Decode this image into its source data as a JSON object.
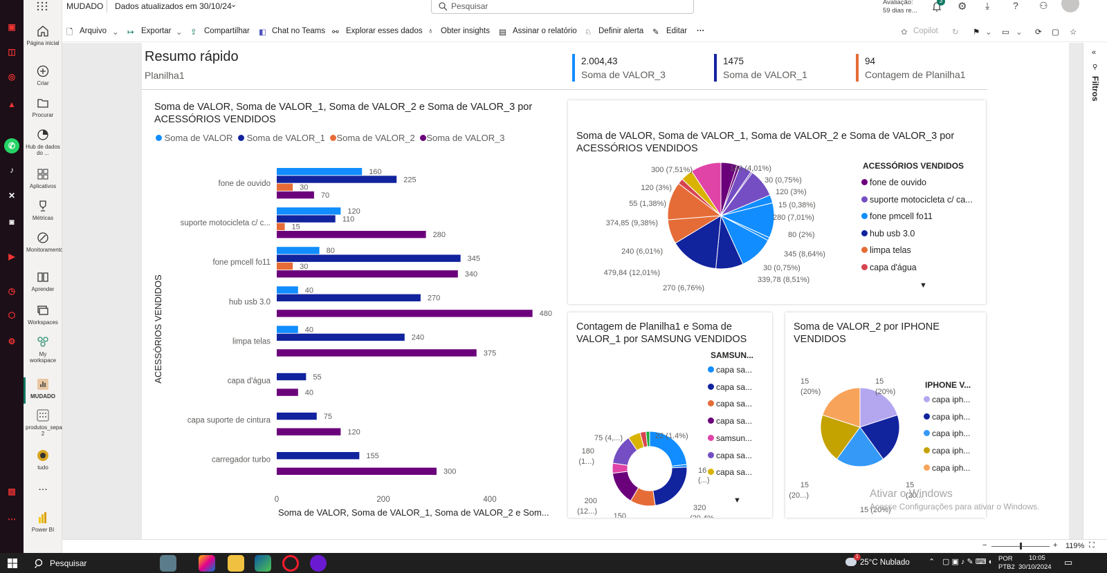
{
  "topbar": {
    "workspace": "MUDADO",
    "updated": "Dados atualizados em 30/10/24",
    "search_placeholder": "Pesquisar",
    "trial_line1": "Avaliação:",
    "trial_line2": "59 dias re...",
    "notif_count": "3"
  },
  "nav": [
    {
      "label": "Página inicial",
      "icon": "home-icon"
    },
    {
      "label": "Criar",
      "icon": "plus-circle-icon"
    },
    {
      "label": "Procurar",
      "icon": "folder-icon"
    },
    {
      "label": "Hub de dados do ...",
      "icon": "data-hub-icon"
    },
    {
      "label": "Aplicativos",
      "icon": "apps-icon"
    },
    {
      "label": "Métricas",
      "icon": "trophy-icon"
    },
    {
      "label": "Monitoramento",
      "icon": "monitor-icon"
    },
    {
      "label": "Aprender",
      "icon": "book-icon"
    },
    {
      "label": "Workspaces",
      "icon": "workspaces-icon"
    },
    {
      "label": "My workspace",
      "icon": "my-workspace-icon"
    },
    {
      "label": "MUDADO",
      "icon": "report-icon"
    },
    {
      "label": "produtos_separados 2",
      "icon": "dataset-icon"
    },
    {
      "label": "tudo",
      "icon": "dataset-icon"
    },
    {
      "label": "...",
      "icon": "more-icon"
    },
    {
      "label": "Power BI",
      "icon": "powerbi-icon"
    }
  ],
  "toolbar": {
    "arquivo": "Arquivo",
    "exportar": "Exportar",
    "compartilhar": "Compartilhar",
    "chat": "Chat no Teams",
    "explorar": "Explorar esses dados",
    "insights": "Obter insights",
    "assinar": "Assinar o relatório",
    "alerta": "Definir alerta",
    "editar": "Editar",
    "more": "···",
    "copilot": "Copilot"
  },
  "header": {
    "title": "Resumo rápido",
    "subtitle": "Planilha1"
  },
  "kpis": [
    {
      "value": "2.004,43",
      "label": "Soma de VALOR_3",
      "color": "#118DFF"
    },
    {
      "value": "1475",
      "label": "Soma de VALOR_1",
      "color": "#12239E"
    },
    {
      "value": "94",
      "label": "Contagem de Planilha1",
      "color": "#E66C37"
    }
  ],
  "bar_chart": {
    "title_line1": "Soma de VALOR, Soma de VALOR_1, Soma de VALOR_2 e Soma de VALOR_3 por",
    "title_line2": "ACESSÓRIOS VENDIDOS",
    "ylabel": "ACESSÓRIOS VENDIDOS",
    "xlabel": "Soma de VALOR, Soma de VALOR_1, Soma de VALOR_2 e Som...",
    "legend": [
      "Soma de VALOR",
      "Soma de VALOR_1",
      "Soma de VALOR_2",
      "Soma de VALOR_3"
    ]
  },
  "pie_accessories": {
    "title_line1": "Soma de VALOR, Soma de VALOR_1, Soma de VALOR_2 e Soma de VALOR_3 por",
    "title_line2": "ACESSÓRIOS VENDIDOS",
    "legend_title": "ACESSÓRIOS  VENDIDOS",
    "legend": [
      {
        "label": "fone de ouvido",
        "color": "#6B007B"
      },
      {
        "label": "suporte motocicleta c/ ca...",
        "color": "#744EC2"
      },
      {
        "label": "fone pmcell fo11",
        "color": "#118DFF"
      },
      {
        "label": "hub usb 3.0",
        "color": "#12239E"
      },
      {
        "label": "limpa telas",
        "color": "#E66C37"
      },
      {
        "label": "capa d'água",
        "color": "#D64550"
      }
    ],
    "labels": [
      "300 (7,51%)",
      "160 (4,01%)",
      "30 (0,75%)",
      "120 (3%)",
      "120 (3%)",
      "15 (0,38%)",
      "55 (1,38%)",
      "280 (7,01%)",
      "374,85 (9,38%)",
      "80 (2%)",
      "240 (6,01%)",
      "345 (8,64%)",
      "479,84 (12,01%)",
      "30 (0,75%)",
      "339,78 (8,51%)",
      "270 (6,76%)"
    ]
  },
  "samsung": {
    "title_line1": "Contagem de Planilha1 e Soma de",
    "title_line2": "VALOR_1 por SAMSUNG VENDIDOS",
    "legend_title": "SAMSUN...",
    "legend": [
      {
        "label": "capa sa...",
        "color": "#118DFF"
      },
      {
        "label": "capa sa...",
        "color": "#12239E"
      },
      {
        "label": "capa sa...",
        "color": "#E66C37"
      },
      {
        "label": "capa sa...",
        "color": "#6B007B"
      },
      {
        "label": "samsun...",
        "color": "#E044A7"
      },
      {
        "label": "capa sa...",
        "color": "#744EC2"
      },
      {
        "label": "capa sa...",
        "color": "#D9B300"
      }
    ],
    "labels": [
      "75 (4,...)",
      "22 (1.4%)",
      "180",
      "(1...)",
      "16",
      "(...)",
      "200",
      "(12...)",
      "320",
      "(20,4%)",
      "150",
      "(9,56%)"
    ]
  },
  "iphone": {
    "title_line1": "Soma de VALOR_2 por IPHONE",
    "title_line2": "VENDIDOS",
    "legend_title": "IPHONE V...",
    "legend": [
      {
        "label": "capa iph...",
        "color": "#B4A7F0"
      },
      {
        "label": "capa iph...",
        "color": "#12239E"
      },
      {
        "label": "capa iph...",
        "color": "#3599F7"
      },
      {
        "label": "capa iph...",
        "color": "#C4A200"
      },
      {
        "label": "capa iph...",
        "color": "#F8A35A"
      }
    ],
    "labels": [
      "15",
      "(20%)",
      "15",
      "(20%)",
      "15",
      "(20...)",
      "15",
      "(20...)",
      "15 (20%)"
    ]
  },
  "watermark": {
    "line1": "Ativar o Windows",
    "line2": "Acesse Configurações para ativar o Windows."
  },
  "filters_label": "Filtros",
  "zoom": "119%",
  "taskbar": {
    "search": "Pesquisar",
    "weather": "25°C  Nublado",
    "lang1": "POR",
    "lang2": "PTB2",
    "time": "10:05",
    "date": "30/10/2024",
    "notif": "1"
  },
  "chart_data": [
    {
      "type": "bar",
      "title": "Soma de VALOR, Soma de VALOR_1, Soma de VALOR_2 e Soma de VALOR_3 por ACESSÓRIOS VENDIDOS",
      "categories": [
        "fone de ouvido",
        "suporte motocicleta c/ c...",
        "fone pmcell fo11",
        "hub usb 3.0",
        "limpa telas",
        "capa d'água",
        "capa suporte de cintura",
        "carregador turbo"
      ],
      "series": [
        {
          "name": "Soma de VALOR",
          "color": "#118DFF",
          "values": [
            160,
            120,
            80,
            40,
            40,
            null,
            null,
            null
          ]
        },
        {
          "name": "Soma de VALOR_1",
          "color": "#12239E",
          "values": [
            225,
            110,
            345,
            270,
            240,
            55,
            75,
            155
          ]
        },
        {
          "name": "Soma de VALOR_2",
          "color": "#E66C37",
          "values": [
            30,
            15,
            30,
            null,
            null,
            null,
            null,
            null
          ]
        },
        {
          "name": "Soma de VALOR_3",
          "color": "#6B007B",
          "values": [
            70,
            280,
            340,
            480,
            375,
            40,
            120,
            300
          ]
        }
      ],
      "xticks": [
        0,
        200,
        400
      ],
      "xlim": [
        0,
        480
      ],
      "xlabel": "Soma de VALOR, Soma de VALOR_1, Soma de VALOR_2 e Som...",
      "ylabel": "ACESSÓRIOS VENDIDOS"
    },
    {
      "type": "pie",
      "title": "Soma de VALOR, Soma de VALOR_1, Soma de VALOR_2 e Soma de VALOR_3 por ACESSÓRIOS VENDIDOS",
      "slices": [
        {
          "value": 160,
          "color": "#6B007B"
        },
        {
          "value": 30,
          "color": "#6B007B"
        },
        {
          "value": 120,
          "color": "#744EC2"
        },
        {
          "value": 15,
          "color": "#744EC2"
        },
        {
          "value": 280,
          "color": "#744EC2"
        },
        {
          "value": 80,
          "color": "#118DFF"
        },
        {
          "value": 345,
          "color": "#118DFF"
        },
        {
          "value": 30,
          "color": "#118DFF"
        },
        {
          "value": 339.78,
          "color": "#118DFF"
        },
        {
          "value": 270,
          "color": "#12239E"
        },
        {
          "value": 479.84,
          "color": "#12239E"
        },
        {
          "value": 240,
          "color": "#E66C37"
        },
        {
          "value": 374.85,
          "color": "#E66C37"
        },
        {
          "value": 55,
          "color": "#D64550"
        },
        {
          "value": 120,
          "color": "#D9B300"
        },
        {
          "value": 300,
          "color": "#E044A7"
        }
      ]
    },
    {
      "type": "pie",
      "donut": true,
      "title": "Contagem de Planilha1 e Soma de VALOR_1 por SAMSUNG VENDIDOS",
      "slices": [
        {
          "value": 320,
          "color": "#118DFF"
        },
        {
          "value": 16,
          "color": "#118DFF"
        },
        {
          "value": 320,
          "color": "#12239E"
        },
        {
          "value": 150,
          "color": "#E66C37"
        },
        {
          "value": 200,
          "color": "#6B007B"
        },
        {
          "value": 60,
          "color": "#E044A7"
        },
        {
          "value": 180,
          "color": "#744EC2"
        },
        {
          "value": 75,
          "color": "#D9B300"
        },
        {
          "value": 35,
          "color": "#D64550"
        },
        {
          "value": 22,
          "color": "#1AAB40"
        }
      ]
    },
    {
      "type": "pie",
      "title": "Soma de VALOR_2 por IPHONE VENDIDOS",
      "slices": [
        {
          "value": 15,
          "color": "#B4A7F0"
        },
        {
          "value": 15,
          "color": "#12239E"
        },
        {
          "value": 15,
          "color": "#3599F7"
        },
        {
          "value": 15,
          "color": "#C4A200"
        },
        {
          "value": 15,
          "color": "#F8A35A"
        }
      ]
    }
  ]
}
